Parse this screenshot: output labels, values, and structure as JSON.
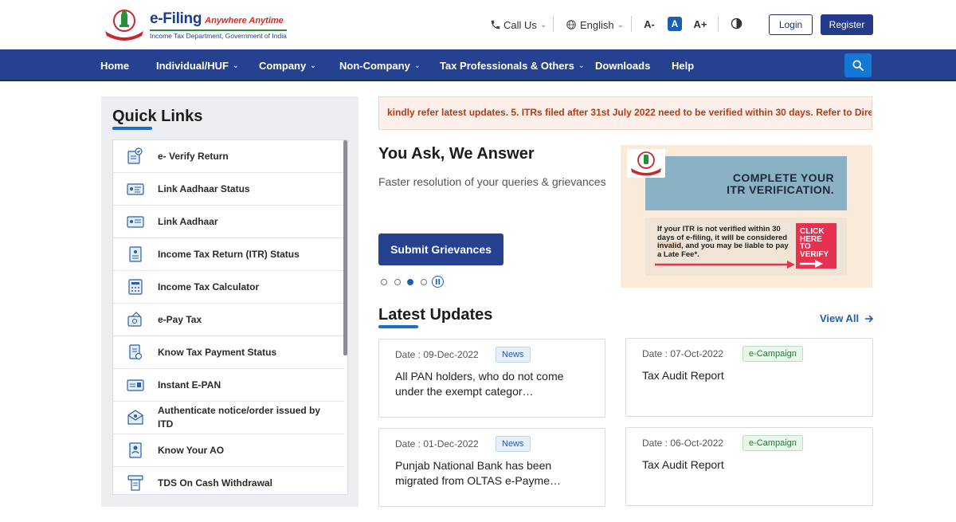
{
  "header": {
    "logo_title": "e-Filing",
    "logo_tagline": "Anywhere Anytime",
    "logo_subtitle": "Income Tax Department, Government of India",
    "call_us": "Call Us",
    "language": "English",
    "font_decrease": "A-",
    "font_normal": "A",
    "font_increase": "A+",
    "login": "Login",
    "register": "Register"
  },
  "nav": {
    "items": [
      {
        "label": "Home",
        "dropdown": false
      },
      {
        "label": "Individual/HUF",
        "dropdown": true
      },
      {
        "label": "Company",
        "dropdown": true
      },
      {
        "label": "Non-Company",
        "dropdown": true
      },
      {
        "label": "Tax Professionals & Others",
        "dropdown": true
      },
      {
        "label": "Downloads",
        "dropdown": false
      },
      {
        "label": "Help",
        "dropdown": false
      }
    ]
  },
  "quick_links": {
    "title": "Quick Links",
    "items": [
      {
        "label": "e- Verify Return",
        "icon": "verify-return-icon"
      },
      {
        "label": "Link Aadhaar Status",
        "icon": "aadhaar-status-icon"
      },
      {
        "label": "Link Aadhaar",
        "icon": "aadhaar-link-icon"
      },
      {
        "label": "Income Tax Return (ITR) Status",
        "icon": "itr-status-icon"
      },
      {
        "label": "Income Tax Calculator",
        "icon": "calculator-icon"
      },
      {
        "label": "e-Pay Tax",
        "icon": "pay-tax-icon"
      },
      {
        "label": "Know Tax Payment Status",
        "icon": "payment-status-icon"
      },
      {
        "label": "Instant E-PAN",
        "icon": "epan-card-icon"
      },
      {
        "label": "Authenticate notice/order issued by ITD",
        "icon": "notice-icon"
      },
      {
        "label": "Know Your AO",
        "icon": "ao-icon"
      },
      {
        "label": "TDS On Cash Withdrawal",
        "icon": "tds-cash-icon"
      }
    ]
  },
  "ticker": {
    "text": "kindly refer latest updates. 5. ITRs filed after 31st July 2022 need to be verified within 30 days. Refer to Direc"
  },
  "you_ask": {
    "title": "You Ask, We Answer",
    "subtitle": "Faster resolution of your queries & grievances",
    "button": "Submit Grievances",
    "carousel_active": 2
  },
  "banner": {
    "heading_line1": "COMPLETE YOUR",
    "heading_line2": "ITR VERIFICATION.",
    "body_pre": "If your ITR is not verified within 30 days of e-filing, it will be considered ",
    "body_highlight": "invalid",
    "body_post": ", and you may be liable to pay a Late Fee*.",
    "cta_line1": "CLICK",
    "cta_line2": "HERE",
    "cta_line3": "TO",
    "cta_line4": "VERIFY"
  },
  "latest_updates": {
    "title": "Latest Updates",
    "view_all": "View All",
    "cards": [
      {
        "date": "Date : 09-Dec-2022",
        "badge": "News",
        "text": "All PAN holders, who do not come under the exempt categor…"
      },
      {
        "date": "Date : 07-Oct-2022",
        "badge": "e-Campaign",
        "text": "Tax Audit Report"
      },
      {
        "date": "Date : 01-Dec-2022",
        "badge": "News",
        "text": "Punjab National Bank has been migrated from OLTAS e-Payme…"
      },
      {
        "date": "Date : 06-Oct-2022",
        "badge": "e-Campaign",
        "text": "Tax Audit Report"
      }
    ]
  },
  "colors": {
    "nav_bg": "#25418f",
    "accent_blue": "#1a5fb4",
    "ticker_text": "#b83a12",
    "panel_bg": "#eceef2"
  }
}
